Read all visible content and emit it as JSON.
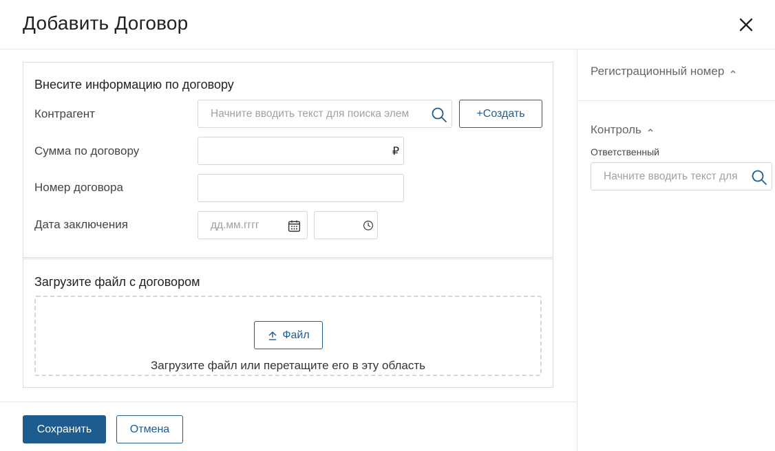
{
  "dialog": {
    "title": "Добавить Договор"
  },
  "info_panel": {
    "title": "Внесите информацию по договору",
    "counterparty": {
      "label": "Контрагент",
      "placeholder": "Начните вводить текст для поиска элем",
      "create_label": "+Создать"
    },
    "amount": {
      "label": "Сумма по договору",
      "currency": "₽"
    },
    "number": {
      "label": "Номер договора"
    },
    "date": {
      "label": "Дата заключения",
      "date_placeholder": "дд.мм.гггг"
    }
  },
  "file_panel": {
    "title": "Загрузите файл с договором",
    "button_label": "Файл",
    "hint": "Загрузите файл или перетащите его в эту область"
  },
  "sidebar": {
    "registration_title": "Регистрационный номер",
    "control_title": "Контроль",
    "responsible_label": "Ответственный",
    "responsible_placeholder": "Начните вводить текст для"
  },
  "footer": {
    "save_label": "Сохранить",
    "cancel_label": "Отмена"
  },
  "colors": {
    "accent": "#1e5b8e",
    "border": "#d6d6d6",
    "placeholder": "#a0a0a0"
  },
  "icons": [
    "close-icon",
    "search-icon",
    "plus-icon",
    "ruble-icon",
    "calendar-icon",
    "clock-icon",
    "upload-icon",
    "chevron-up-icon"
  ]
}
